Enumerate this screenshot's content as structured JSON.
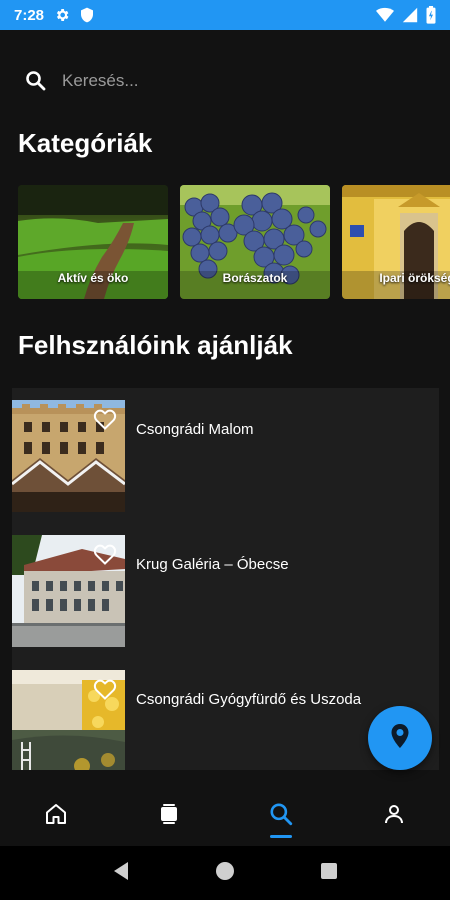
{
  "status_bar": {
    "time": "7:28",
    "icons": [
      "gear-icon",
      "shield-icon",
      "wifi-icon",
      "signal-icon",
      "battery-icon"
    ],
    "background_color": "#2196f3"
  },
  "search": {
    "placeholder": "Keresés...",
    "icon": "search-icon"
  },
  "categories": {
    "title": "Kategóriák",
    "items": [
      {
        "label": "Aktív és öko"
      },
      {
        "label": "Borászatok"
      },
      {
        "label": "Ipari örökség"
      }
    ]
  },
  "recommendations": {
    "title": "Felhsználóink ajánlják",
    "items": [
      {
        "title": "Csongrádi Malom",
        "favorite": false
      },
      {
        "title": "Krug Galéria – Óbecse",
        "favorite": false
      },
      {
        "title": "Csongrádi Gyógyfürdő és Uszoda",
        "favorite": false
      }
    ]
  },
  "fab": {
    "icon": "map-pin-icon",
    "color": "#2196f3"
  },
  "bottom_nav": {
    "items": [
      {
        "icon": "home-icon",
        "active": false
      },
      {
        "icon": "cards-icon",
        "active": false
      },
      {
        "icon": "search-icon",
        "active": true
      },
      {
        "icon": "profile-icon",
        "active": false
      }
    ],
    "accent_color": "#2196f3"
  },
  "system_nav": {
    "icons": [
      "back-icon",
      "home-circle-icon",
      "recents-icon"
    ]
  }
}
